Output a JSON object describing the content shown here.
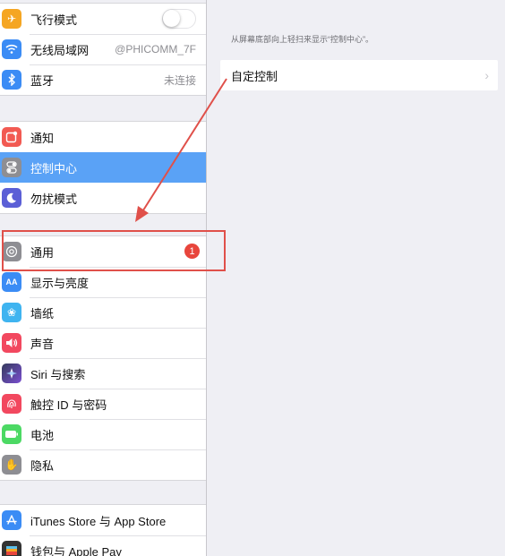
{
  "sidebar": {
    "group1": [
      {
        "label": "飞行模式",
        "icon": "airplane-icon",
        "color": "#f5a623",
        "control": "toggle"
      },
      {
        "label": "无线局域网",
        "icon": "wifi-icon",
        "color": "#3b8cf5",
        "value": "@PHICOMM_7F"
      },
      {
        "label": "蓝牙",
        "icon": "bluetooth-icon",
        "color": "#3b8cf5",
        "value": "未连接"
      }
    ],
    "group2": [
      {
        "label": "通知",
        "icon": "notifications-icon",
        "color": "#f25a52"
      },
      {
        "label": "控制中心",
        "icon": "control-center-icon",
        "color": "#8e8e93",
        "selected": true
      },
      {
        "label": "勿扰模式",
        "icon": "moon-icon",
        "color": "#5b5fd6"
      }
    ],
    "group3": [
      {
        "label": "通用",
        "icon": "gear-icon",
        "color": "#8e8e93",
        "badge": "1"
      },
      {
        "label": "显示与亮度",
        "icon": "display-brightness-icon",
        "color": "#3b8cf5"
      },
      {
        "label": "墙纸",
        "icon": "wallpaper-icon",
        "color": "#3fb4f0"
      },
      {
        "label": "声音",
        "icon": "speaker-icon",
        "color": "#f2485f"
      },
      {
        "label": "Siri 与搜索",
        "icon": "siri-icon",
        "color": "#343a5c"
      },
      {
        "label": "触控 ID 与密码",
        "icon": "fingerprint-icon",
        "color": "#f2485f"
      },
      {
        "label": "电池",
        "icon": "battery-icon",
        "color": "#4cd964"
      },
      {
        "label": "隐私",
        "icon": "hand-icon",
        "color": "#8e8e93"
      }
    ],
    "group4": [
      {
        "label": "iTunes Store 与 App Store",
        "icon": "app-store-icon",
        "color": "#3b8cf5"
      },
      {
        "label": "钱包与 Apple Pay",
        "icon": "wallet-icon",
        "color": "#333333"
      }
    ]
  },
  "detail": {
    "hint": "从屏幕底部向上轻扫来显示“控制中心”。",
    "row_label": "自定控制"
  },
  "annotation": {
    "color": "#e0504a"
  }
}
